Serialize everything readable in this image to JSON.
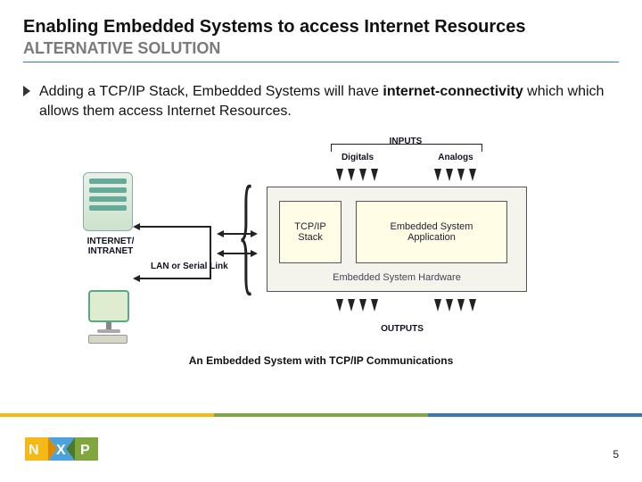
{
  "title": "Enabling Embedded Systems to access Internet Resources",
  "subtitle": "ALTERNATIVE SOLUTION",
  "bullet": {
    "pre": "Adding a TCP/IP Stack, Embedded Systems will have ",
    "bold": "internet-connectivity",
    "post": " which which allows them access Internet Resources."
  },
  "diagram": {
    "server_label": "INTERNET/\nINTRANET",
    "link_label": "LAN or Serial Link",
    "tcp_box": "TCP/IP\nStack",
    "app_box": "Embedded System\nApplication",
    "hw_label": "Embedded System Hardware",
    "inputs": "INPUTS",
    "digitals": "Digitals",
    "analogs": "Analogs",
    "outputs": "OUTPUTS",
    "caption": "An Embedded System with TCP/IP Communications"
  },
  "brand": {
    "logo_alt": "NXP"
  },
  "page_number": "5",
  "colors": {
    "accent_blue": "#2a7cc0",
    "bar_yellow": "#f5b915",
    "bar_green": "#7fa73e",
    "bar_blue": "#3a77b5"
  }
}
